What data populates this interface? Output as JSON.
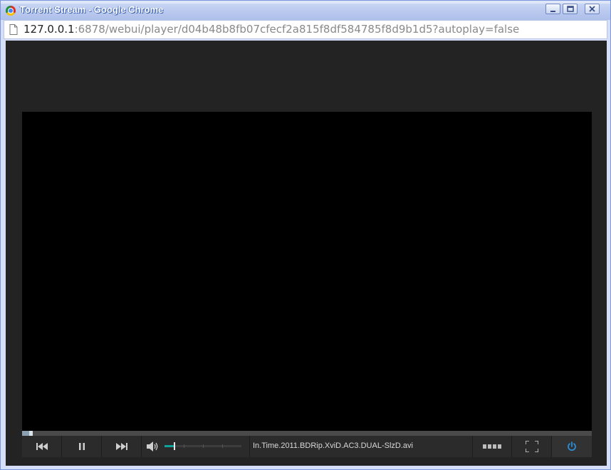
{
  "window": {
    "title": "Torrent Stream - Google Chrome",
    "controls": [
      "minimize-icon",
      "maximize-icon",
      "close-icon"
    ]
  },
  "address_bar": {
    "url_host": "127.0.0.1",
    "url_rest": ":6878/webui/player/d04b48b8fb07cfecf2a815f8df584785f8d9b1d5?autoplay=false"
  },
  "player": {
    "progress": 0.013,
    "buffered": 0.013,
    "volume": 0.12,
    "filename": "In.Time.2011.BDRip.XviD.AC3.DUAL-SlzD.avi",
    "accent_color": "#0fa39c",
    "power_color": "#2b8ed6",
    "icons": [
      "previous-icon",
      "pause-icon",
      "next-icon",
      "volume-icon",
      "playlist-icon",
      "fullscreen-icon",
      "power-icon"
    ]
  }
}
